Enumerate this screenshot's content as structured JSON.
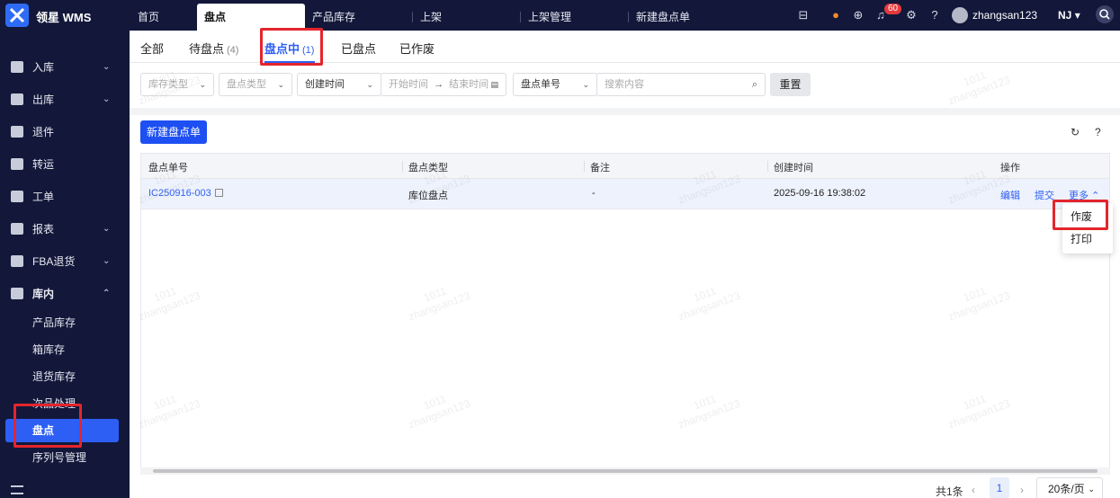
{
  "app": {
    "brand": "领星 WMS"
  },
  "top_tabs": [
    {
      "label": "首页"
    },
    {
      "label": "盘点"
    },
    {
      "label": "产品库存"
    },
    {
      "label": "上架"
    },
    {
      "label": "上架管理"
    },
    {
      "label": "新建盘点单"
    }
  ],
  "header": {
    "notification_count": "60",
    "username": "zhangsan123",
    "warehouse": "NJ"
  },
  "sidebar": {
    "items": [
      {
        "label": "入库",
        "chevron": "⌄"
      },
      {
        "label": "出库",
        "chevron": "⌄"
      },
      {
        "label": "退件",
        "chevron": ""
      },
      {
        "label": "转运",
        "chevron": ""
      },
      {
        "label": "工单",
        "chevron": ""
      },
      {
        "label": "报表",
        "chevron": "⌄"
      },
      {
        "label": "FBA退货",
        "chevron": "⌄"
      },
      {
        "label": "库内",
        "chevron": "⌃"
      }
    ],
    "sub_items": [
      "产品库存",
      "箱库存",
      "退货库存",
      "次品处理",
      "盘点",
      "序列号管理"
    ]
  },
  "status_tabs": [
    {
      "label": "全部",
      "count": ""
    },
    {
      "label": "待盘点",
      "count": "(4)"
    },
    {
      "label": "盘点中",
      "count": "(1)"
    },
    {
      "label": "已盘点",
      "count": ""
    },
    {
      "label": "已作废",
      "count": ""
    }
  ],
  "filters": {
    "stock_type_placeholder": "库存类型",
    "count_type_placeholder": "盘点类型",
    "time_field": "创建时间",
    "start_placeholder": "开始时间",
    "range_arrow": "→",
    "end_placeholder": "结束时间",
    "search_field": "盘点单号",
    "search_placeholder": "搜索内容",
    "reset_label": "重置"
  },
  "toolbar": {
    "new_button": "新建盘点单"
  },
  "table": {
    "columns": [
      "盘点单号",
      "盘点类型",
      "备注",
      "创建时间",
      "操作"
    ],
    "rows": [
      {
        "order_no": "IC250916-003",
        "count_type": "库位盘点",
        "remark": "-",
        "created": "2025-09-16 19:38:02",
        "actions": [
          "编辑",
          "提交",
          "更多"
        ]
      }
    ]
  },
  "more_menu": [
    "作废",
    "打印"
  ],
  "pagination": {
    "total": "共1条",
    "current": "1",
    "page_size": "20条/页"
  },
  "watermark": {
    "line1": "1011",
    "line2": "zhangsan123"
  },
  "colors": {
    "nav_bg": "#13183a",
    "accent": "#2d5ff5",
    "highlight": "#e4252c"
  }
}
